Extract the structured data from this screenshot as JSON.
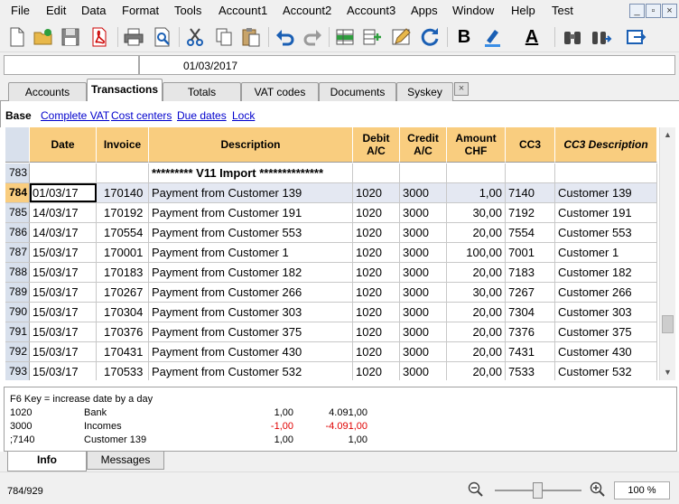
{
  "menu": {
    "items": [
      "File",
      "Edit",
      "Data",
      "Format",
      "Tools",
      "Account1",
      "Account2",
      "Account3",
      "Apps",
      "Window",
      "Help",
      "Test"
    ],
    "window_buttons": [
      "_",
      "▫",
      "×"
    ]
  },
  "toolbar": {
    "icons": [
      "new-file-icon",
      "open-folder-icon",
      "save-icon",
      "pdf-icon",
      "print-icon",
      "print-preview-icon",
      "cut-icon",
      "copy-icon",
      "paste-icon",
      "undo-icon",
      "redo-icon",
      "add-row-icon",
      "insert-column-icon",
      "edit-pencil-icon",
      "refresh-icon",
      "bold-icon",
      "highlight-icon",
      "font-color-icon",
      "find-icon",
      "find-replace-icon",
      "export-icon"
    ],
    "bold_label": "B",
    "font_color_label": "A"
  },
  "cellbar": {
    "reference": "",
    "content": "01/03/2017"
  },
  "tabs": [
    {
      "label": "Accounts",
      "active": false
    },
    {
      "label": "Transactions",
      "active": true
    },
    {
      "label": "Totals",
      "active": false
    },
    {
      "label": "VAT codes",
      "active": false
    },
    {
      "label": "Documents",
      "active": false
    },
    {
      "label": "Syskey",
      "active": false
    }
  ],
  "tab_close_label": "×",
  "views": [
    {
      "label": "Base",
      "active": true
    },
    {
      "label": "Complete VAT",
      "active": false
    },
    {
      "label": "Cost centers",
      "active": false
    },
    {
      "label": "Due dates",
      "active": false
    },
    {
      "label": "Lock",
      "active": false
    }
  ],
  "grid": {
    "columns": [
      "",
      "Date",
      "Invoice",
      "Description",
      "Debit A/C",
      "Credit A/C",
      "Amount CHF",
      "CC3",
      "CC3 Description"
    ],
    "rows": [
      {
        "n": "783",
        "date": "",
        "invoice": "",
        "desc": "********* V11 Import **************",
        "debit": "",
        "credit": "",
        "amount": "",
        "cc3": "",
        "cc3desc": "",
        "import": true
      },
      {
        "n": "784",
        "date": "01/03/17",
        "invoice": "170140",
        "desc": "Payment from Customer 139",
        "debit": "1020",
        "credit": "3000",
        "amount": "1,00",
        "cc3": "7140",
        "cc3desc": "Customer 139",
        "selected": true
      },
      {
        "n": "785",
        "date": "14/03/17",
        "invoice": "170192",
        "desc": "Payment from Customer 191",
        "debit": "1020",
        "credit": "3000",
        "amount": "30,00",
        "cc3": "7192",
        "cc3desc": "Customer 191"
      },
      {
        "n": "786",
        "date": "14/03/17",
        "invoice": "170554",
        "desc": "Payment from Customer 553",
        "debit": "1020",
        "credit": "3000",
        "amount": "20,00",
        "cc3": "7554",
        "cc3desc": "Customer 553"
      },
      {
        "n": "787",
        "date": "15/03/17",
        "invoice": "170001",
        "desc": "Payment from Customer 1",
        "debit": "1020",
        "credit": "3000",
        "amount": "100,00",
        "cc3": "7001",
        "cc3desc": "Customer 1"
      },
      {
        "n": "788",
        "date": "15/03/17",
        "invoice": "170183",
        "desc": "Payment from Customer 182",
        "debit": "1020",
        "credit": "3000",
        "amount": "20,00",
        "cc3": "7183",
        "cc3desc": "Customer 182"
      },
      {
        "n": "789",
        "date": "15/03/17",
        "invoice": "170267",
        "desc": "Payment from Customer 266",
        "debit": "1020",
        "credit": "3000",
        "amount": "30,00",
        "cc3": "7267",
        "cc3desc": "Customer 266"
      },
      {
        "n": "790",
        "date": "15/03/17",
        "invoice": "170304",
        "desc": "Payment from Customer 303",
        "debit": "1020",
        "credit": "3000",
        "amount": "20,00",
        "cc3": "7304",
        "cc3desc": "Customer 303"
      },
      {
        "n": "791",
        "date": "15/03/17",
        "invoice": "170376",
        "desc": "Payment from Customer 375",
        "debit": "1020",
        "credit": "3000",
        "amount": "20,00",
        "cc3": "7376",
        "cc3desc": "Customer 375"
      },
      {
        "n": "792",
        "date": "15/03/17",
        "invoice": "170431",
        "desc": "Payment from Customer 430",
        "debit": "1020",
        "credit": "3000",
        "amount": "20,00",
        "cc3": "7431",
        "cc3desc": "Customer 430"
      },
      {
        "n": "793",
        "date": "15/03/17",
        "invoice": "170533",
        "desc": "Payment from Customer 532",
        "debit": "1020",
        "credit": "3000",
        "amount": "20,00",
        "cc3": "7533",
        "cc3desc": "Customer 532"
      }
    ]
  },
  "info": {
    "hint": "F6 Key = increase date by a day",
    "lines": [
      {
        "account": "1020",
        "name": "Bank",
        "amount": "1,00",
        "balance": "4.091,00",
        "negative": false
      },
      {
        "account": "3000",
        "name": "Incomes",
        "amount": "-1,00",
        "balance": "-4.091,00",
        "negative": true
      },
      {
        "account": ";7140",
        "name": "Customer 139",
        "amount": "1,00",
        "balance": "1,00",
        "negative": false
      }
    ]
  },
  "info_tabs": [
    {
      "label": "Info",
      "active": true
    },
    {
      "label": "Messages",
      "active": false
    }
  ],
  "status": {
    "position": "784/929",
    "zoom": "100 %"
  },
  "colors": {
    "header_bg": "#f9cd7f",
    "selected_row_bg": "#e4e8f2",
    "row_number_bg": "#d8e0ec",
    "negative": "#e00000",
    "link": "#0000cc"
  }
}
